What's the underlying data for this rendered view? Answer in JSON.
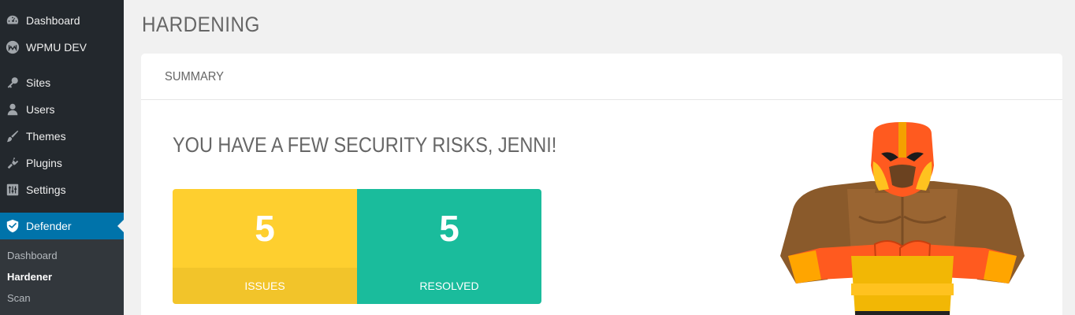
{
  "sidebar": {
    "items": [
      {
        "label": "Dashboard",
        "icon": "dashboard-icon"
      },
      {
        "label": "WPMU DEV",
        "icon": "wpmudev-icon"
      },
      {
        "label": "Sites",
        "icon": "key-icon"
      },
      {
        "label": "Users",
        "icon": "user-icon"
      },
      {
        "label": "Themes",
        "icon": "brush-icon"
      },
      {
        "label": "Plugins",
        "icon": "plug-icon"
      },
      {
        "label": "Settings",
        "icon": "sliders-icon"
      },
      {
        "label": "Defender",
        "icon": "shield-icon"
      }
    ],
    "submenu": [
      "Dashboard",
      "Hardener",
      "Scan"
    ],
    "active_color": "#0073aa"
  },
  "page": {
    "title": "HARDENING"
  },
  "summary": {
    "header": "SUMMARY",
    "headline": "YOU HAVE A FEW SECURITY RISKS, JENNI!",
    "issues": {
      "value": "5",
      "label": "ISSUES",
      "color": "#fecf2f"
    },
    "resolved": {
      "value": "5",
      "label": "RESOLVED",
      "color": "#1abc9c"
    }
  }
}
